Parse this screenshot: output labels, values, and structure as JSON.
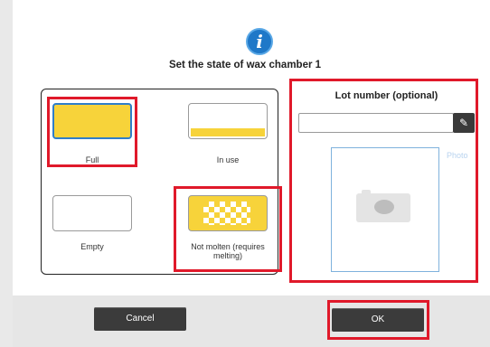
{
  "dialog": {
    "title": "Set the state of wax chamber 1",
    "icon": "info-icon"
  },
  "states": [
    {
      "label": "Full",
      "selected": true
    },
    {
      "label": "In use",
      "selected": false
    },
    {
      "label": "Empty",
      "selected": false
    },
    {
      "label": "Not molten (requires melting)",
      "selected": false
    }
  ],
  "lot": {
    "title": "Lot number (optional)",
    "value": "",
    "edit_icon": "pencil-icon",
    "photo_icon": "camera-icon",
    "photo_link": "Photo"
  },
  "footer": {
    "cancel_label": "Cancel",
    "ok_label": "OK"
  },
  "colors": {
    "wax": "#f7d33a",
    "highlight": "#e0192a",
    "selected_border": "#2f7ec9",
    "button": "#3b3b3b"
  }
}
